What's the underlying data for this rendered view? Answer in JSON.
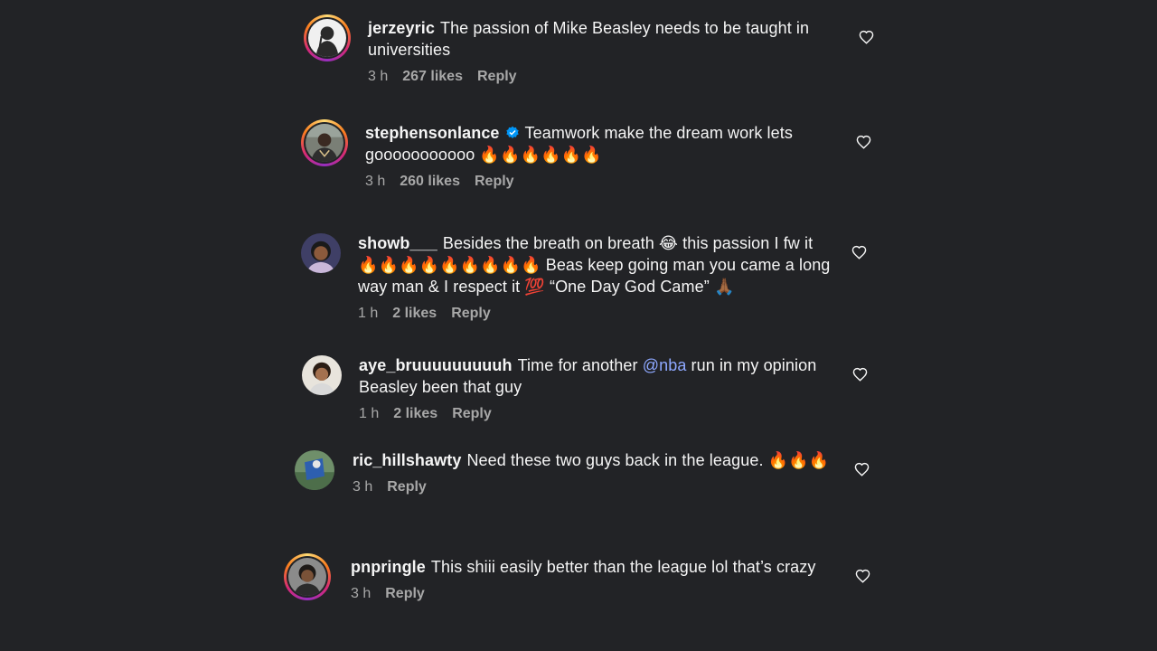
{
  "comments": [
    {
      "username": "jerzeyric",
      "text": "The passion of Mike Beasley needs to be taught in universities",
      "time": "3 h",
      "likes": "267 likes",
      "reply": "Reply"
    },
    {
      "username": "stephensonlance",
      "text": "Teamwork make the dream work lets gooooooooooo 🔥🔥🔥🔥🔥🔥",
      "time": "3 h",
      "likes": "260 likes",
      "reply": "Reply"
    },
    {
      "username": "showb___",
      "text": "Besides the breath on breath 😂 this passion I fw it 🔥🔥🔥🔥🔥🔥🔥🔥🔥 Beas keep going man you came a long way man & I respect it 💯 “One Day God Came” 🙏🏾",
      "time": "1 h",
      "likes": "2 likes",
      "reply": "Reply"
    },
    {
      "username": "aye_bruuuuuuuuuh",
      "text_before": "Time for another",
      "mention": "@nba",
      "text_after": "run in my opinion Beasley been that guy",
      "time": "1 h",
      "likes": "2 likes",
      "reply": "Reply"
    },
    {
      "username": "ric_hillshawty",
      "text": "Need these two guys back in the league. 🔥🔥🔥",
      "time": "3 h",
      "reply": "Reply"
    },
    {
      "username": "pnpringle",
      "text": "This shiii easily better than the league lol that’s crazy",
      "time": "3 h",
      "reply": "Reply"
    }
  ],
  "icons": {
    "like": "heart-outline-icon",
    "verified": "verified-badge-icon"
  },
  "colors": {
    "background": "#222326",
    "text": "#f5f5f5",
    "meta": "#a8a8a8",
    "mention": "#8ea8ff",
    "verified": "#0095f6"
  }
}
